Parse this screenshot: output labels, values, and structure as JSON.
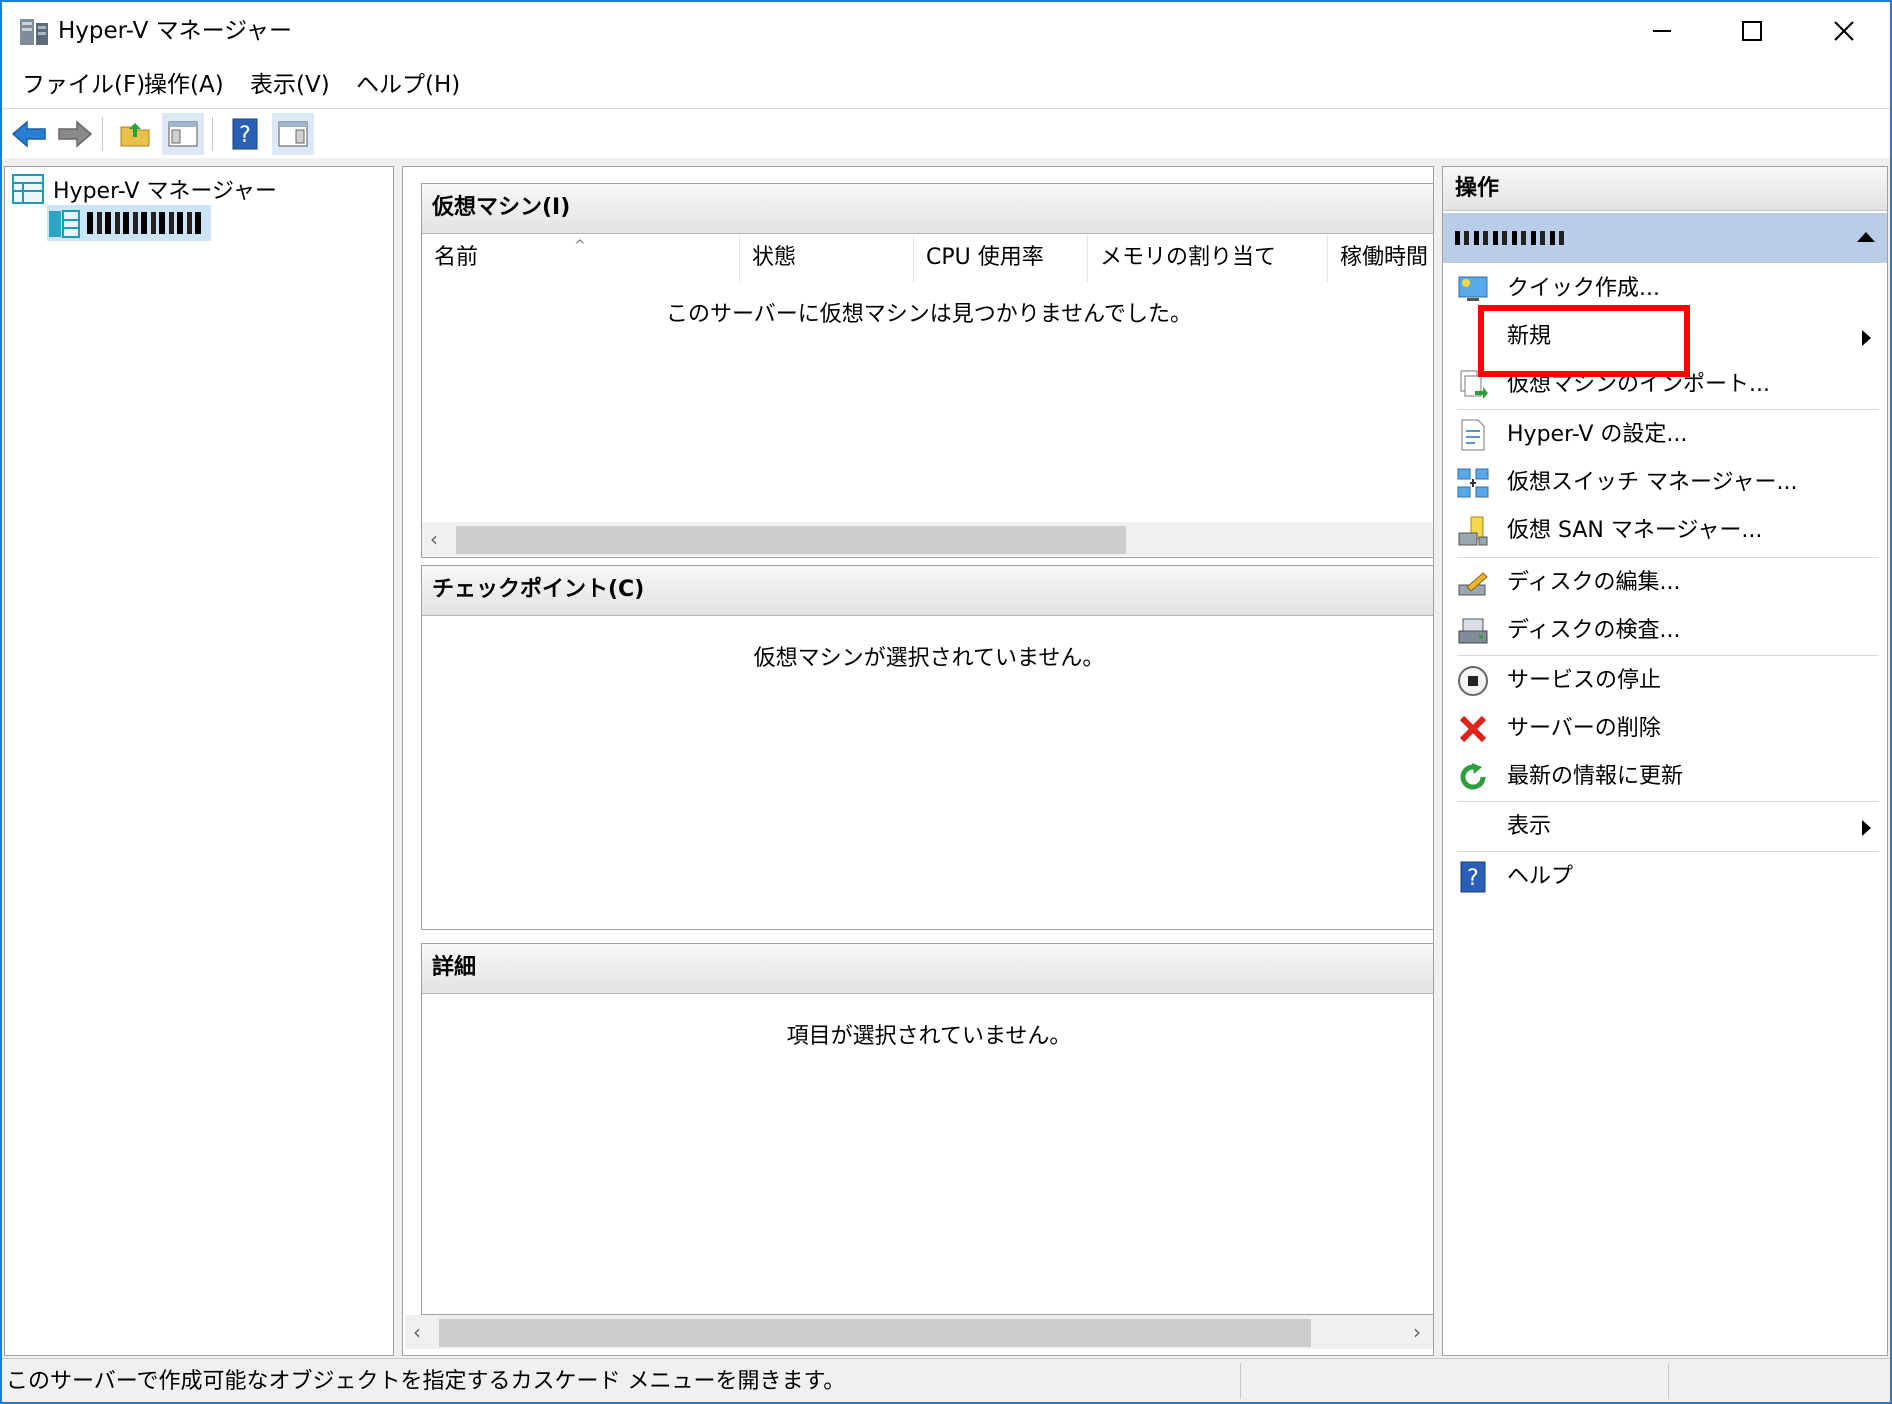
{
  "window": {
    "title": "Hyper-V マネージャー"
  },
  "menubar": {
    "items": [
      "ファイル(F)",
      "操作(A)",
      "表示(V)",
      "ヘルプ(H)"
    ]
  },
  "toolbar": {
    "buttons": [
      "back-icon",
      "forward-icon",
      "up-folder-icon",
      "show-hide-tree-icon",
      "help-icon",
      "show-hide-action-pane-icon"
    ]
  },
  "tree": {
    "root_label": "Hyper-V マネージャー",
    "server_label": "(obscured server name)"
  },
  "center": {
    "vm_section": {
      "title": "仮想マシン(I)",
      "columns": [
        "名前",
        "状態",
        "CPU 使用率",
        "メモリの割り当て",
        "稼働時間"
      ],
      "empty_message": "このサーバーに仮想マシンは見つかりませんでした。"
    },
    "checkpoint_section": {
      "title": "チェックポイント(C)",
      "empty_message": "仮想マシンが選択されていません。"
    },
    "details_section": {
      "title": "詳細",
      "empty_message": "項目が選択されていません。"
    }
  },
  "actions": {
    "header": "操作",
    "items": [
      {
        "label": "クイック作成...",
        "icon": "quick-create-icon",
        "submenu": false
      },
      {
        "label": "新規",
        "icon": "",
        "submenu": true,
        "highlighted": true
      },
      {
        "label": "仮想マシンのインポート...",
        "icon": "import-vm-icon",
        "submenu": false
      },
      {
        "label": "Hyper-V の設定...",
        "icon": "settings-doc-icon",
        "submenu": false
      },
      {
        "label": "仮想スイッチ マネージャー...",
        "icon": "virtual-switch-icon",
        "submenu": false
      },
      {
        "label": "仮想 SAN マネージャー...",
        "icon": "virtual-san-icon",
        "submenu": false
      },
      {
        "label": "ディスクの編集...",
        "icon": "edit-disk-icon",
        "submenu": false
      },
      {
        "label": "ディスクの検査...",
        "icon": "inspect-disk-icon",
        "submenu": false
      },
      {
        "label": "サービスの停止",
        "icon": "stop-service-icon",
        "submenu": false
      },
      {
        "label": "サーバーの削除",
        "icon": "remove-server-icon",
        "submenu": false
      },
      {
        "label": "最新の情報に更新",
        "icon": "refresh-icon",
        "submenu": false
      },
      {
        "label": "表示",
        "icon": "",
        "submenu": true
      },
      {
        "label": "ヘルプ",
        "icon": "help-icon",
        "submenu": false
      }
    ]
  },
  "statusbar": {
    "text": "このサーバーで作成可能なオブジェクトを指定するカスケード メニューを開きます。"
  },
  "colors": {
    "accent_border": "#1f7ad9",
    "selected_header": "#b9cde8",
    "highlight": "#ff0000"
  }
}
